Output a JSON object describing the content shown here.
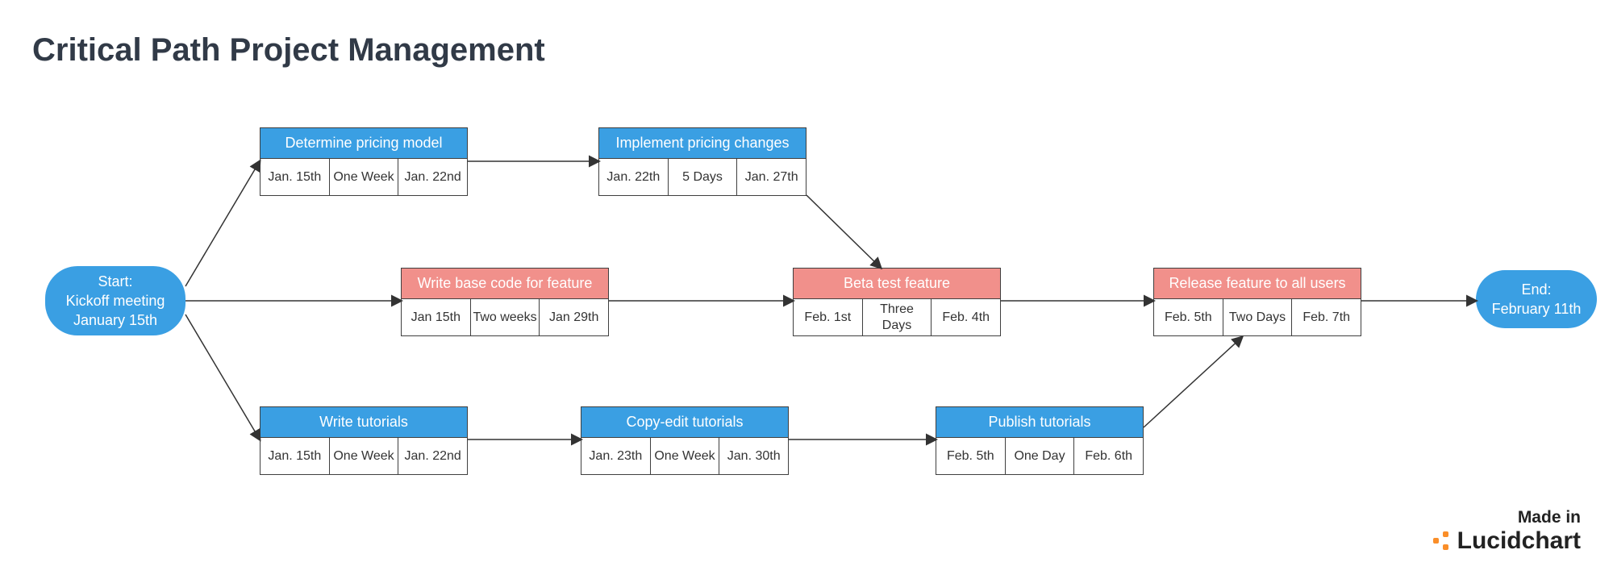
{
  "title": "Critical Path Project Management",
  "start": {
    "label1": "Start:",
    "label2": "Kickoff meeting",
    "label3": "January 15th"
  },
  "end": {
    "label1": "End:",
    "label2": "February 11th"
  },
  "nodes": {
    "pricing_model": {
      "title": "Determine pricing model",
      "c1": "Jan. 15th",
      "c2": "One Week",
      "c3": "Jan. 22nd",
      "color": "blue"
    },
    "pricing_changes": {
      "title": "Implement pricing changes",
      "c1": "Jan. 22th",
      "c2": "5 Days",
      "c3": "Jan. 27th",
      "color": "blue"
    },
    "base_code": {
      "title": "Write base code for feature",
      "c1": "Jan 15th",
      "c2": "Two weeks",
      "c3": "Jan 29th",
      "color": "red"
    },
    "beta_test": {
      "title": "Beta test feature",
      "c1": "Feb. 1st",
      "c2": "Three Days",
      "c3": "Feb. 4th",
      "color": "red"
    },
    "release": {
      "title": "Release feature to all users",
      "c1": "Feb. 5th",
      "c2": "Two Days",
      "c3": "Feb. 7th",
      "color": "red"
    },
    "write_tut": {
      "title": "Write tutorials",
      "c1": "Jan. 15th",
      "c2": "One Week",
      "c3": "Jan. 22nd",
      "color": "blue"
    },
    "copyedit": {
      "title": "Copy-edit tutorials",
      "c1": "Jan. 23th",
      "c2": "One Week",
      "c3": "Jan. 30th",
      "color": "blue"
    },
    "publish": {
      "title": "Publish tutorials",
      "c1": "Feb. 5th",
      "c2": "One Day",
      "c3": "Feb. 6th",
      "color": "blue"
    }
  },
  "watermark": {
    "line1": "Made in",
    "line2": "Lucidchart"
  }
}
